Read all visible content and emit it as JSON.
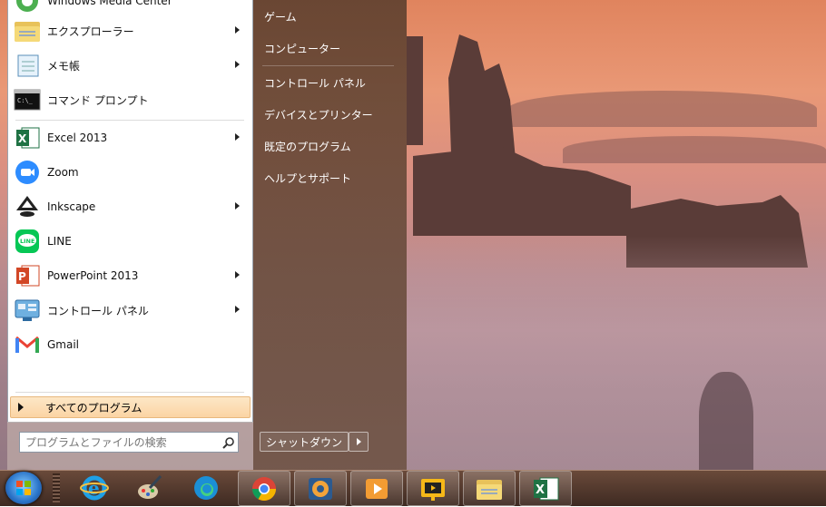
{
  "left_pane": {
    "items": [
      {
        "label": "Windows Media Center",
        "icon": "media-center-icon",
        "arrow": false
      },
      {
        "label": "エクスプローラー",
        "icon": "folder-icon",
        "arrow": true
      },
      {
        "label": "メモ帳",
        "icon": "notepad-icon",
        "arrow": true
      },
      {
        "label": "コマンド プロンプト",
        "icon": "terminal-icon",
        "arrow": false
      },
      {
        "label": "Excel 2013",
        "icon": "excel-icon",
        "arrow": true
      },
      {
        "label": "Zoom",
        "icon": "zoom-icon",
        "arrow": false
      },
      {
        "label": "Inkscape",
        "icon": "inkscape-icon",
        "arrow": true
      },
      {
        "label": "LINE",
        "icon": "line-icon",
        "arrow": false
      },
      {
        "label": "PowerPoint 2013",
        "icon": "powerpoint-icon",
        "arrow": true
      },
      {
        "label": "コントロール パネル",
        "icon": "control-panel-icon",
        "arrow": true
      },
      {
        "label": "Gmail",
        "icon": "gmail-icon",
        "arrow": false
      }
    ],
    "all_programs": "すべてのプログラム",
    "search_placeholder": "プログラムとファイルの検索"
  },
  "right_pane": {
    "items": [
      "ゲーム",
      "コンピューター",
      "コントロール パネル",
      "デバイスとプリンター",
      "既定のプログラム",
      "ヘルプとサポート"
    ],
    "shutdown": "シャットダウン"
  },
  "taskbar": {
    "items": [
      "internet-explorer-icon",
      "paint-icon",
      "edge-icon",
      "chrome-icon",
      "media-player-icon",
      "video-player-icon",
      "slides-icon",
      "explorer-icon",
      "excel-icon"
    ],
    "active_items": [
      "chrome-icon",
      "media-player-icon",
      "video-player-icon",
      "slides-icon",
      "explorer-icon",
      "excel-icon"
    ]
  },
  "colors": {
    "excel": "#1f7244",
    "zoom": "#2d8cff",
    "line": "#06c755",
    "powerpoint": "#d24726",
    "gmail_red": "#ea4335",
    "highlight": "#fbd4a4"
  }
}
